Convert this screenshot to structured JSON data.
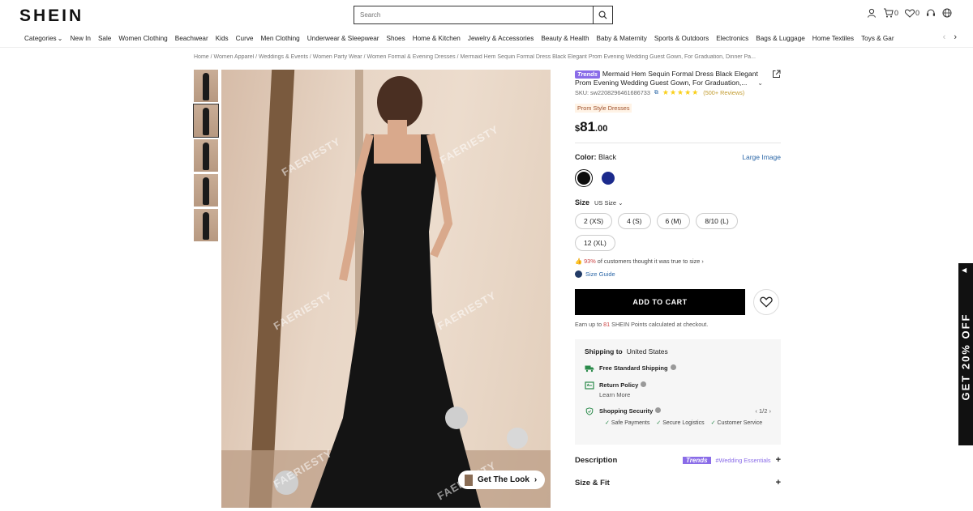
{
  "header": {
    "logo": "SHEIN",
    "search_placeholder": "Search",
    "cart_count": "0",
    "wishlist_count": "0"
  },
  "nav": {
    "items": [
      "Categories",
      "New In",
      "Sale",
      "Women Clothing",
      "Beachwear",
      "Kids",
      "Curve",
      "Men Clothing",
      "Underwear & Sleepwear",
      "Shoes",
      "Home & Kitchen",
      "Jewelry & Accessories",
      "Beauty & Health",
      "Baby & Maternity",
      "Sports & Outdoors",
      "Electronics",
      "Bags & Luggage",
      "Home Textiles",
      "Toys & Gar"
    ]
  },
  "breadcrumb": "Home / Women Apparel / Weddings & Events / Women Party Wear / Women Formal & Evening Dresses / Mermaid Hem Sequin Formal Dress Black Elegant Prom Evening Wedding Guest Gown, For Graduation, Dinner Pa...",
  "gallery": {
    "watermark": "FAERIESTY",
    "get_the_look": "Get The Look"
  },
  "product": {
    "trend_tag": "Trends",
    "title": "Mermaid Hem Sequin Formal Dress Black Elegant Prom Evening Wedding Guest Gown, For Graduation,...",
    "sku": "SKU: sw2208296461686733",
    "stars": "★★★★★",
    "reviews": "(500+ Reviews)",
    "style_badge": "Prom Style Dresses",
    "price_currency": "$",
    "price_whole": "81",
    "price_cents": ".00",
    "color_label": "Color:",
    "color_value": "Black",
    "large_image": "Large Image",
    "swatch_colors": [
      "#0d0d0d",
      "#1b2a8c"
    ],
    "size_label": "Size",
    "size_system": "US Size",
    "sizes": [
      "2 (XS)",
      "4 (S)",
      "6 (M)",
      "8/10 (L)",
      "12 (XL)"
    ],
    "fit_pct": "93%",
    "fit_text": "of customers thought it was true to size",
    "size_guide": "Size Guide",
    "add_to_cart": "ADD TO CART",
    "points_pre": "Earn up to",
    "points_num": "81",
    "points_post": "SHEIN Points calculated at checkout."
  },
  "shipping": {
    "label": "Shipping to",
    "country": "United States",
    "free_shipping": "Free Standard Shipping",
    "return_policy": "Return Policy",
    "learn_more": "Learn More",
    "security": "Shopping Security",
    "pager": "1/2",
    "security_items": [
      "Safe Payments",
      "Secure Logistics",
      "Customer Service"
    ]
  },
  "sections": {
    "description": "Description",
    "desc_tag": "Trends",
    "desc_link": "#Wedding Essentials",
    "size_fit": "Size & Fit"
  },
  "promo": {
    "text": "GET 20% OFF"
  },
  "colors": {
    "accent_trend": "#8a6ce8",
    "link_blue": "#2d68a8",
    "star": "#facf19"
  }
}
